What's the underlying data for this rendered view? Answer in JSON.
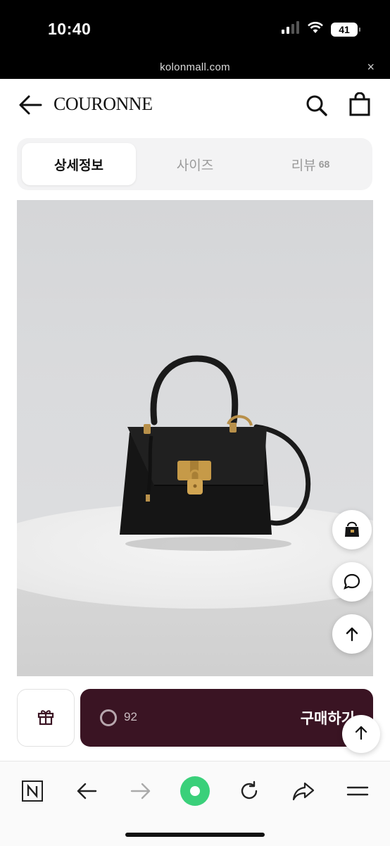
{
  "status_bar": {
    "time": "10:40",
    "battery": "41"
  },
  "browser": {
    "url": "kolonmall.com",
    "close_label": "×"
  },
  "header": {
    "brand": "COURONNE"
  },
  "tabs": [
    {
      "label": "상세정보",
      "active": true
    },
    {
      "label": "사이즈",
      "active": false
    },
    {
      "label": "리뷰",
      "count": "68",
      "active": false
    }
  ],
  "buy_bar": {
    "count": "92",
    "buy_label": "구매하기"
  },
  "colors": {
    "buy_button": "#3a1423",
    "accent_green": "#3ad07a",
    "tab_bg": "#f3f3f4"
  },
  "icons": {
    "status": [
      "signal-icon",
      "wifi-icon",
      "battery-icon"
    ],
    "header": [
      "back-arrow-icon",
      "search-icon",
      "shopping-bag-icon"
    ],
    "floating": [
      "product-thumbnail",
      "chat-icon",
      "arrow-up-icon"
    ],
    "buy_bar": [
      "gift-icon",
      "loading-ring-icon"
    ],
    "bottom_nav": [
      "naver-n-icon",
      "back-icon",
      "forward-icon",
      "home-dot-icon",
      "reload-icon",
      "share-icon",
      "menu-icon"
    ]
  }
}
